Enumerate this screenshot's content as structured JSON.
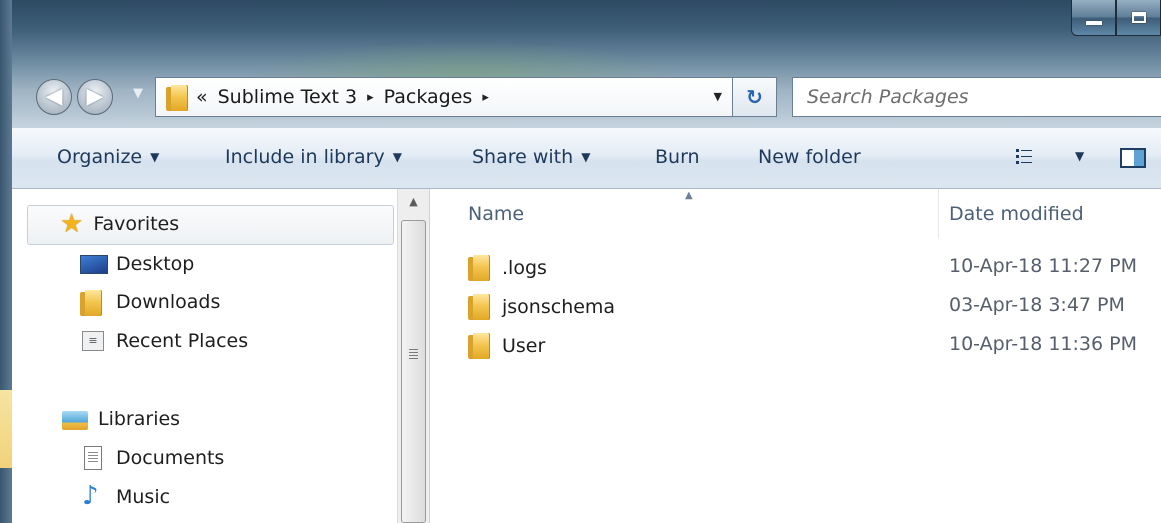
{
  "window": {
    "caption_buttons": [
      "minimize",
      "maximize"
    ]
  },
  "navigation": {
    "back_icon": "back-arrow-icon",
    "forward_icon": "forward-arrow-icon"
  },
  "address_bar": {
    "overflow": "«",
    "segments": [
      "Sublime Text 3",
      "Packages"
    ],
    "separator": "▸"
  },
  "search": {
    "placeholder": "Search Packages"
  },
  "toolbar": {
    "organize": "Organize",
    "include_in_library": "Include in library",
    "share_with": "Share with",
    "burn": "Burn",
    "new_folder": "New folder"
  },
  "nav_pane": {
    "favorites": {
      "label": "Favorites",
      "items": [
        "Desktop",
        "Downloads",
        "Recent Places"
      ]
    },
    "libraries": {
      "label": "Libraries",
      "items": [
        "Documents",
        "Music"
      ]
    }
  },
  "file_list": {
    "columns": {
      "name": "Name",
      "date_modified": "Date modified"
    },
    "rows": [
      {
        "name": ".logs",
        "date": "10-Apr-18 11:27 PM",
        "type": "folder"
      },
      {
        "name": "jsonschema",
        "date": "03-Apr-18 3:47 PM",
        "type": "folder"
      },
      {
        "name": "User",
        "date": "10-Apr-18 11:36 PM",
        "type": "folder"
      }
    ]
  },
  "colors": {
    "toolbar_text": "#1e395b",
    "column_header": "#4c607a",
    "folder_yellow": "#f3c650"
  }
}
